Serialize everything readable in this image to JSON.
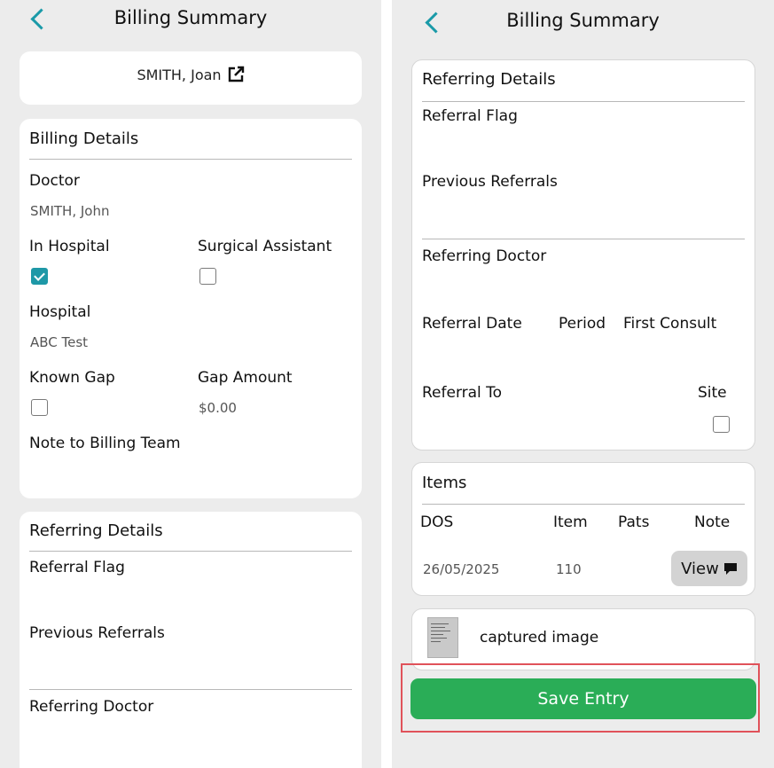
{
  "header": {
    "title": "Billing Summary"
  },
  "patient": {
    "name": "SMITH, Joan"
  },
  "billing": {
    "title": "Billing Details",
    "doctor_label": "Doctor",
    "doctor_value": "SMITH, John",
    "in_hospital_label": "In Hospital",
    "in_hospital_checked": true,
    "surgical_assistant_label": "Surgical Assistant",
    "surgical_assistant_checked": false,
    "hospital_label": "Hospital",
    "hospital_value": "ABC Test",
    "known_gap_label": "Known Gap",
    "known_gap_checked": false,
    "gap_amount_label": "Gap Amount",
    "gap_amount_value": "$0.00",
    "note_label": "Note to Billing Team"
  },
  "referring": {
    "title": "Referring Details",
    "flag_label": "Referral Flag",
    "previous_label": "Previous Referrals",
    "doctor_label": "Referring Doctor",
    "date_label": "Referral Date",
    "period_label": "Period",
    "first_consult_label": "First Consult",
    "to_label": "Referral To",
    "site_label": "Site",
    "site_checked": false
  },
  "items": {
    "title": "Items",
    "columns": [
      "DOS",
      "Item",
      "Pats",
      "Note"
    ],
    "rows": [
      {
        "dos": "26/05/2025",
        "item": "110",
        "pats": "",
        "view_label": "View"
      }
    ]
  },
  "attachment": {
    "label": "captured image"
  },
  "save": {
    "label": "Save Entry"
  },
  "colors": {
    "accent": "#1e98a7",
    "save_button": "#2aad57",
    "highlight": "#e0525a",
    "background": "#ececec"
  }
}
